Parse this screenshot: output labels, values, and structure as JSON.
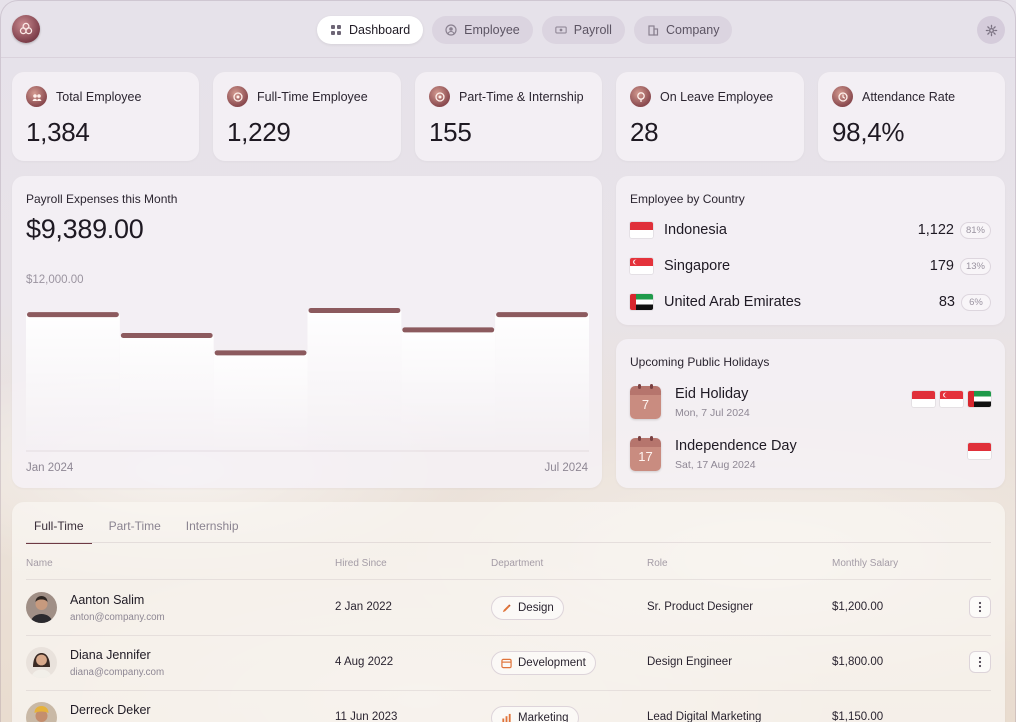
{
  "nav": {
    "items": [
      {
        "label": "Dashboard",
        "icon": "grid-icon",
        "active": true
      },
      {
        "label": "Employee",
        "icon": "users-icon",
        "active": false
      },
      {
        "label": "Payroll",
        "icon": "money-icon",
        "active": false
      },
      {
        "label": "Company",
        "icon": "building-icon",
        "active": false
      }
    ]
  },
  "stats": [
    {
      "label": "Total Employee",
      "value": "1,384",
      "icon": "team-icon"
    },
    {
      "label": "Full-Time Employee",
      "value": "1,229",
      "icon": "target-icon"
    },
    {
      "label": "Part-Time & Internship",
      "value": "155",
      "icon": "target-icon"
    },
    {
      "label": "On Leave Employee",
      "value": "28",
      "icon": "leave-icon"
    },
    {
      "label": "Attendance Rate",
      "value": "98,4%",
      "icon": "attendance-icon"
    }
  ],
  "payroll": {
    "title": "Payroll Expenses this Month",
    "amount": "$9,389.00",
    "axis_max_label": "$12,000.00",
    "x_start": "Jan 2024",
    "x_end": "Jul 2024"
  },
  "chart_data": {
    "type": "bar",
    "categories": [
      "Jan 2024",
      "",
      "",
      "",
      "",
      "Jul 2024"
    ],
    "values": [
      9800,
      8300,
      7050,
      10100,
      8700,
      9800
    ],
    "ylim": [
      0,
      12000
    ],
    "title": "Payroll Expenses this Month",
    "xlabel": "",
    "ylabel": "",
    "grid": false,
    "bar_color": "#8c5a5e"
  },
  "countries": {
    "title": "Employee by Country",
    "items": [
      {
        "name": "Indonesia",
        "count": "1,122",
        "pct": "81%",
        "flag": "indonesia-flag"
      },
      {
        "name": "Singapore",
        "count": "179",
        "pct": "13%",
        "flag": "singapore-flag"
      },
      {
        "name": "United Arab Emirates",
        "count": "83",
        "pct": "6%",
        "flag": "uae-flag"
      }
    ]
  },
  "holidays": {
    "title": "Upcoming Public Holidays",
    "items": [
      {
        "day": "7",
        "name": "Eid Holiday",
        "date": "Mon, 7 Jul 2024"
      },
      {
        "day": "17",
        "name": "Independence Day",
        "date": "Sat, 17 Aug 2024"
      }
    ]
  },
  "table": {
    "tabs": [
      "Full-Time",
      "Part-Time",
      "Internship"
    ],
    "active_tab": "Full-Time",
    "headers": {
      "name": "Name",
      "hired": "Hired Since",
      "department": "Department",
      "role": "Role",
      "salary": "Monthly Salary"
    },
    "rows": [
      {
        "name": "Aanton Salim",
        "email": "anton@company.com",
        "hired": "2 Jan 2022",
        "department": "Design",
        "dept_icon": "brush-icon",
        "role": "Sr. Product Designer",
        "salary": "$1,200.00"
      },
      {
        "name": "Diana Jennifer",
        "email": "diana@company.com",
        "hired": "4 Aug 2022",
        "department": "Development",
        "dept_icon": "code-icon",
        "role": "Design Engineer",
        "salary": "$1,800.00"
      },
      {
        "name": "Derreck Deker",
        "email": "",
        "hired": "11 Jun 2023",
        "department": "Marketing",
        "dept_icon": "chart-icon",
        "role": "Lead Digital Marketing",
        "salary": "$1,150.00"
      }
    ]
  },
  "colors": {
    "accent": "#8c5a5e",
    "brand": "#7d3e4a"
  }
}
